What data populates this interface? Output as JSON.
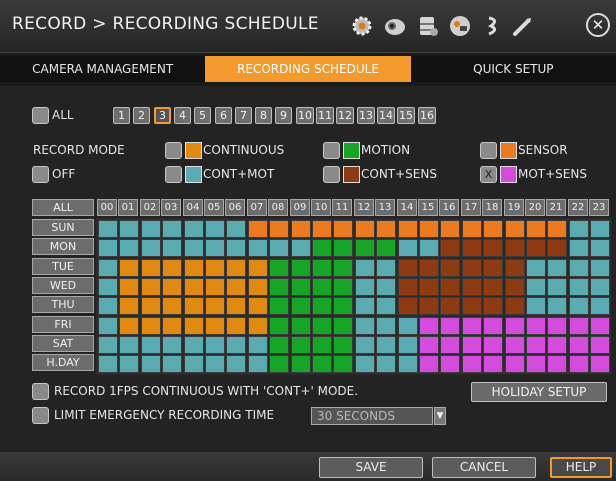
{
  "title": "RECORD > RECORDING SCHEDULE",
  "icons": [
    "gear-icon",
    "camera-icon",
    "storage-icon",
    "network-icon",
    "audio-icon",
    "tool-icon"
  ],
  "tabs": [
    {
      "label": "CAMERA MANAGEMENT",
      "active": false
    },
    {
      "label": "RECORDING SCHEDULE",
      "active": true
    },
    {
      "label": "QUICK SETUP",
      "active": false
    }
  ],
  "channel_all_label": "ALL",
  "channels": [
    "1",
    "2",
    "3",
    "4",
    "5",
    "6",
    "7",
    "8",
    "9",
    "10",
    "11",
    "12",
    "13",
    "14",
    "15",
    "16"
  ],
  "selected_channel": "3",
  "record_mode_label": "RECORD MODE",
  "off_label": "OFF",
  "modes": [
    {
      "key": "C",
      "label": "CONTINUOUS",
      "color": "#e08a12",
      "checked": false
    },
    {
      "key": "M",
      "label": "MOTION",
      "color": "#17a527",
      "checked": false
    },
    {
      "key": "S",
      "label": "SENSOR",
      "color": "#ec7a1e",
      "checked": false
    },
    {
      "key": "CM",
      "label": "CONT+MOT",
      "color": "#5aaab2",
      "checked": false
    },
    {
      "key": "CS",
      "label": "CONT+SENS",
      "color": "#8e3a12",
      "checked": false
    },
    {
      "key": "MS",
      "label": "MOT+SENS",
      "color": "#d44cde",
      "checked": true,
      "mark": "X"
    }
  ],
  "grid_all_label": "ALL",
  "hours": [
    "00",
    "01",
    "02",
    "03",
    "04",
    "05",
    "06",
    "07",
    "08",
    "09",
    "10",
    "11",
    "12",
    "13",
    "14",
    "15",
    "16",
    "17",
    "18",
    "19",
    "20",
    "21",
    "22",
    "23"
  ],
  "days": [
    {
      "label": "SUN",
      "row": "TTTTTTTSSSSSSSSSSSSSSSTT"
    },
    {
      "label": "MON",
      "row": "TTTTTTTTTTMMMMTTBBBBBBTTTT"
    },
    {
      "label": "TUE",
      "row": "TCCCCCCCMMMMTTBBBBBBTTTT"
    },
    {
      "label": "WED",
      "row": "TCCCCCCCMMMMTTBBBBBBTTTT"
    },
    {
      "label": "THU",
      "row": "TCCCCCCCMMMMTTBBBBBBTTTT"
    },
    {
      "label": "FRI",
      "row": "TCCCCCCCMMMMTTTPPPPPPPPP"
    },
    {
      "label": "SAT",
      "row": "TTTTTTTTMMMMTTTPPPPPPPPP"
    },
    {
      "label": "H.DAY",
      "row": "TTTTTTTTMMMMTTTPPPPPPPPP"
    }
  ],
  "record_1fps_label": "RECORD 1FPS CONTINUOUS WITH 'CONT+' MODE.",
  "holiday_setup_label": "HOLIDAY SETUP",
  "limit_emergency_label": "LIMIT EMERGENCY RECORDING TIME",
  "emergency_time_value": "30 SECONDS",
  "footer": {
    "save": "SAVE",
    "cancel": "CANCEL",
    "help": "HELP"
  },
  "colors": {
    "T": "#5aaab2",
    "C": "#e08a12",
    "M": "#17a527",
    "S": "#ec7a1e",
    "B": "#8e3a12",
    "P": "#d44cde",
    "accent": "#f39a2e"
  }
}
